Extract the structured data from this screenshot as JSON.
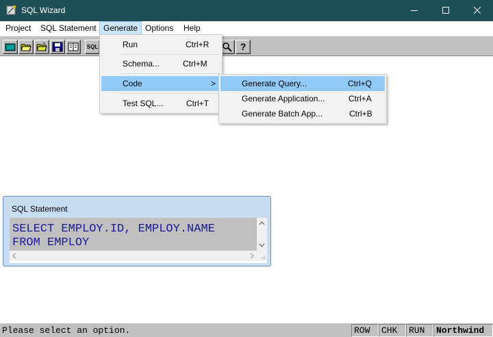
{
  "window": {
    "title": "SQL Wizard"
  },
  "menubar": {
    "items": [
      {
        "label": "Project"
      },
      {
        "label": "SQL Statement"
      },
      {
        "label": "Generate"
      },
      {
        "label": "Options"
      },
      {
        "label": "Help"
      }
    ]
  },
  "toolbar": {
    "buttons": [
      {
        "icon": "new-project-icon"
      },
      {
        "icon": "open-folder-icon"
      },
      {
        "icon": "open-folder-yellow-icon"
      },
      {
        "icon": "save-disk-icon"
      },
      {
        "icon": "book-icon"
      },
      {
        "icon": "sql-icon",
        "label": "SQL"
      },
      {
        "icon": "magnify-icon"
      },
      {
        "icon": "help-question-icon",
        "label": "?"
      }
    ]
  },
  "generate_menu": {
    "items": [
      {
        "label": "Run",
        "shortcut": "Ctrl+R"
      },
      {
        "label": "Schema...",
        "shortcut": "Ctrl+M"
      },
      {
        "label": "Code",
        "submenu_arrow": ">"
      },
      {
        "label": "Test SQL...",
        "shortcut": "Ctrl+T"
      }
    ]
  },
  "code_submenu": {
    "items": [
      {
        "label": "Generate Query...",
        "shortcut": "Ctrl+Q"
      },
      {
        "label": "Generate Application...",
        "shortcut": "Ctrl+A"
      },
      {
        "label": "Generate Batch App...",
        "shortcut": "Ctrl+B"
      }
    ]
  },
  "sql_panel": {
    "title": "SQL Statement",
    "line1": "SELECT EMPLOY.ID, EMPLOY.NAME",
    "line2": "FROM EMPLOY"
  },
  "statusbar": {
    "message": "Please select an option.",
    "indicators": [
      "ROW",
      "CHK",
      "RUN"
    ],
    "database": "Northwind"
  },
  "colors": {
    "titlebar": "#1f4f56",
    "menu_highlight": "#91c9f7",
    "sql_text": "#1a1a99",
    "panel_bg": "#c7dcf1"
  }
}
